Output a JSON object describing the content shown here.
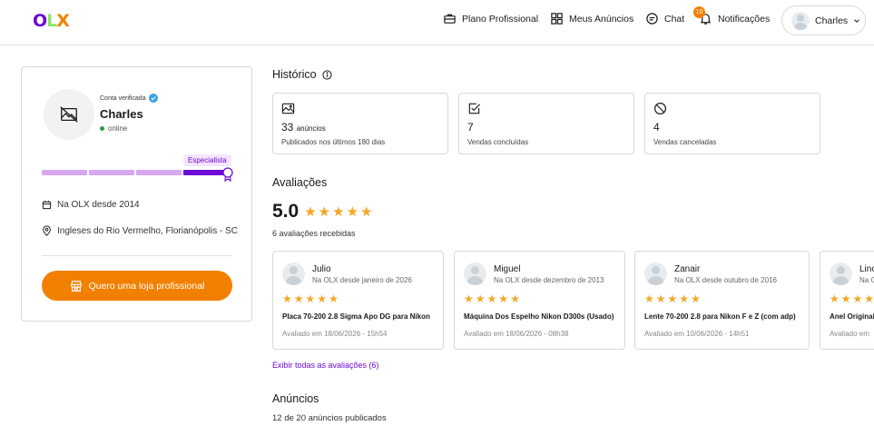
{
  "header": {
    "logo": {
      "o": "O",
      "l": "L",
      "x": "X"
    },
    "nav": {
      "plano": "Plano Profissional",
      "anuncios": "Meus Anúncios",
      "chat": "Chat",
      "notificacoes": "Notificações",
      "notif_count": "10"
    },
    "user": "Charles"
  },
  "profile": {
    "verified": "Conta verificada",
    "name": "Charles",
    "status": "online",
    "level": "Especialista",
    "progress_segments": 4,
    "progress_filled": 4,
    "since": "Na OLX desde 2014",
    "location": "Ingleses do Rio Vermelho, Florianópolis - SC",
    "cta": "Quero uma loja profissional"
  },
  "historico": {
    "title": "Histórico",
    "stats": [
      {
        "value": "33",
        "unit": "anúncios",
        "label": "Publicados nos últimos 180 dias",
        "icon": "image-icon"
      },
      {
        "value": "7",
        "unit": "",
        "label": "Vendas concluídas",
        "icon": "check-square-icon"
      },
      {
        "value": "4",
        "unit": "",
        "label": "Vendas canceladas",
        "icon": "cancel-icon"
      }
    ]
  },
  "avaliacoes": {
    "title": "Avaliações",
    "score": "5.0",
    "stars": 5,
    "count": "6 avaliações recebidas",
    "reviews": [
      {
        "name": "Julio",
        "since": "Na OLX desde janeiro de 2026",
        "stars": 5,
        "title": "Placa 70-200 2.8 Sigma Apo DG para Nikon",
        "date": "Avaliado em 18/06/2026 - 15h54"
      },
      {
        "name": "Miguel",
        "since": "Na OLX desde dezembro de 2013",
        "stars": 5,
        "title": "Máquina Dos Espelho Nikon D300s (Usado)",
        "date": "Avaliado em 18/06/2026 - 08h38"
      },
      {
        "name": "Zanair",
        "since": "Na OLX desde outubro de 2016",
        "stars": 5,
        "title": "Lente 70-200 2.8 para Nikon F e Z (com adp)",
        "date": "Avaliado em 10/06/2026 - 14h51"
      },
      {
        "name": "Lino",
        "since": "Na OLX desde",
        "stars": 5,
        "title": "Anel Original",
        "date": "Avaliado em"
      }
    ],
    "link": "Exibir todas as avaliações (6)"
  },
  "anuncios": {
    "title": "Anúncios",
    "subtitle": "12 de 20 anúncios publicados"
  },
  "colors": {
    "accent": "#6e0ad6",
    "orange": "#f28000",
    "progress_light": "#d7a8f0",
    "progress_dark": "#6e0ad6",
    "star": "#f5a623"
  }
}
